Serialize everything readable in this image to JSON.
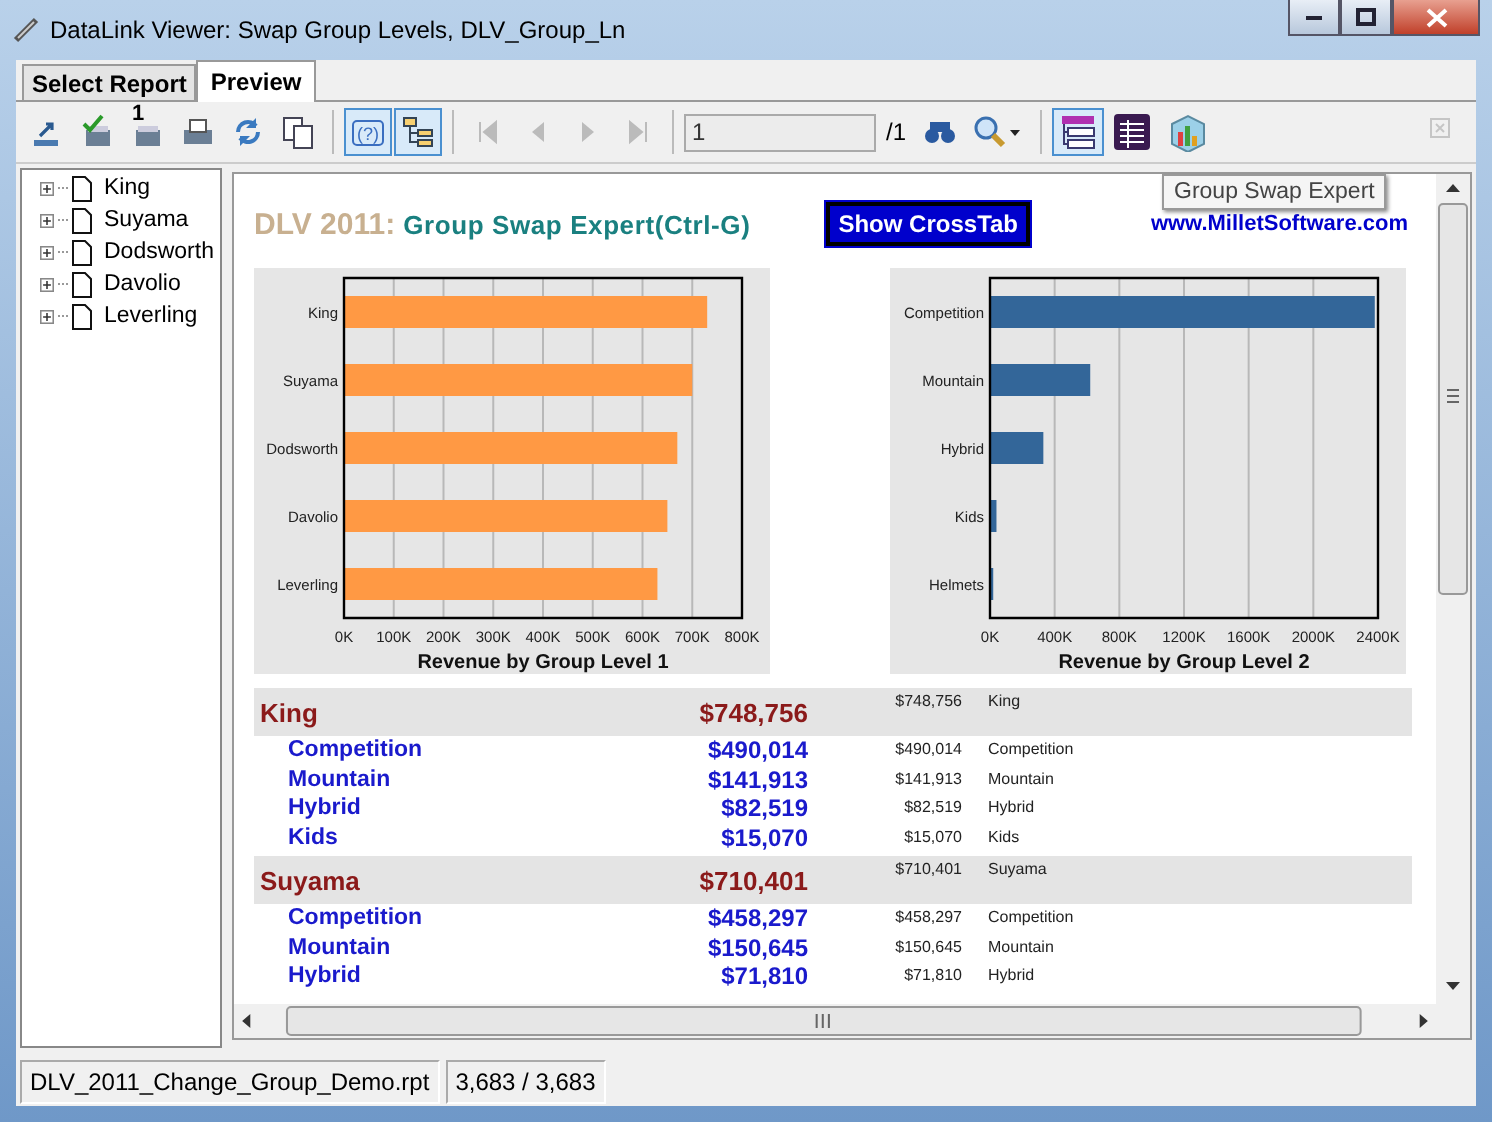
{
  "window": {
    "title": "DataLink Viewer:  Swap Group Levels, DLV_Group_Ln"
  },
  "tabs": [
    {
      "label": "Select Report",
      "selected": false
    },
    {
      "label": "Preview",
      "selected": true
    }
  ],
  "toolbar": {
    "buttons": [
      {
        "kind": "export",
        "pressed": false,
        "disabled": false
      },
      {
        "kind": "check",
        "pressed": false,
        "disabled": false
      },
      {
        "kind": "print-one",
        "badge": "1",
        "pressed": false,
        "disabled": false
      },
      {
        "kind": "print",
        "pressed": false,
        "disabled": false
      },
      {
        "kind": "refresh",
        "pressed": false,
        "disabled": false
      },
      {
        "kind": "copy",
        "pressed": false,
        "disabled": false
      },
      {
        "kind": "sep"
      },
      {
        "kind": "help",
        "glyph": "(?)",
        "pressed": true,
        "disabled": false
      },
      {
        "kind": "tree",
        "pressed": true,
        "disabled": false
      },
      {
        "kind": "sep"
      },
      {
        "kind": "first",
        "pressed": false,
        "disabled": true
      },
      {
        "kind": "prev",
        "pressed": false,
        "disabled": true
      },
      {
        "kind": "next",
        "pressed": false,
        "disabled": true
      },
      {
        "kind": "last",
        "pressed": false,
        "disabled": true
      },
      {
        "kind": "sep"
      },
      {
        "kind": "page",
        "value": "1",
        "total": "/1"
      },
      {
        "kind": "find",
        "pressed": false,
        "disabled": false
      },
      {
        "kind": "zoom",
        "pressed": false,
        "disabled": false
      },
      {
        "kind": "sep"
      },
      {
        "kind": "swap",
        "pressed": true,
        "disabled": false
      },
      {
        "kind": "crosstab",
        "pressed": false,
        "disabled": false
      },
      {
        "kind": "chart",
        "pressed": false,
        "disabled": false
      },
      {
        "kind": "close",
        "pressed": false,
        "disabled": true
      }
    ],
    "tooltip": "Group Swap Expert"
  },
  "tree": {
    "items": [
      {
        "label": "King",
        "expanded": false
      },
      {
        "label": "Suyama",
        "expanded": false
      },
      {
        "label": "Dodsworth",
        "expanded": false
      },
      {
        "label": "Davolio",
        "expanded": false
      },
      {
        "label": "Leverling",
        "expanded": false
      }
    ]
  },
  "report": {
    "title_prefix": "DLV 2011:",
    "title": "Group Swap Expert(Ctrl-G)",
    "button": "Show CrossTab",
    "website": "www.MilletSoftware.com",
    "charts": [
      {
        "chart_data": {
          "type": "bar",
          "orientation": "horizontal",
          "xlabel": "Revenue by Group Level 1",
          "categories": [
            "King",
            "Suyama",
            "Dodsworth",
            "Davolio",
            "Leverling"
          ],
          "grid": true,
          "series": [
            {
              "color": "#ff9944",
              "values": [
                730000,
                700000,
                670000,
                650000,
                630000
              ]
            }
          ],
          "xlim": [
            0,
            800000
          ],
          "xticks": [
            {
              "value": 0,
              "label": "0K"
            },
            {
              "value": 100000,
              "label": "100K"
            },
            {
              "value": 200000,
              "label": "200K"
            },
            {
              "value": 300000,
              "label": "300K"
            },
            {
              "value": 400000,
              "label": "400K"
            },
            {
              "value": 500000,
              "label": "500K"
            },
            {
              "value": 600000,
              "label": "600K"
            },
            {
              "value": 700000,
              "label": "700K"
            },
            {
              "value": 800000,
              "label": "800K"
            }
          ]
        }
      },
      {
        "chart_data": {
          "type": "bar",
          "orientation": "horizontal",
          "xlabel": "Revenue by Group Level 2",
          "categories": [
            "Competition",
            "Mountain",
            "Hybrid",
            "Kids",
            "Helmets"
          ],
          "grid": true,
          "series": [
            {
              "color": "#336699",
              "values": [
                2380000,
                620000,
                330000,
                40000,
                20000
              ]
            }
          ],
          "xlim": [
            0,
            2400000
          ],
          "xticks": [
            {
              "value": 0,
              "label": "0K"
            },
            {
              "value": 400000,
              "label": "400K"
            },
            {
              "value": 800000,
              "label": "800K"
            },
            {
              "value": 1200000,
              "label": "1200K"
            },
            {
              "value": 1600000,
              "label": "1600K"
            },
            {
              "value": 2000000,
              "label": "2000K"
            },
            {
              "value": 2400000,
              "label": "2400K"
            }
          ]
        }
      }
    ],
    "groups": [
      {
        "name": "King",
        "total": "$748,756",
        "total_small": "$748,756",
        "name_small": "King",
        "children": [
          {
            "name": "Competition",
            "total": "$490,014",
            "total_small": "$490,014",
            "name_small": "Competition"
          },
          {
            "name": "Mountain",
            "total": "$141,913",
            "total_small": "$141,913",
            "name_small": "Mountain"
          },
          {
            "name": "Hybrid",
            "total": "$82,519",
            "total_small": "$82,519",
            "name_small": "Hybrid"
          },
          {
            "name": "Kids",
            "total": "$15,070",
            "total_small": "$15,070",
            "name_small": "Kids"
          }
        ]
      },
      {
        "name": "Suyama",
        "total": "$710,401",
        "total_small": "$710,401",
        "name_small": "Suyama",
        "children": [
          {
            "name": "Competition",
            "total": "$458,297",
            "total_small": "$458,297",
            "name_small": "Competition"
          },
          {
            "name": "Mountain",
            "total": "$150,645",
            "total_small": "$150,645",
            "name_small": "Mountain"
          },
          {
            "name": "Hybrid",
            "total": "$71,810",
            "total_small": "$71,810",
            "name_small": "Hybrid"
          }
        ]
      }
    ]
  },
  "status_bar": [
    "DLV_2011_Change_Group_Demo.rpt",
    "3,683 / 3,683"
  ]
}
